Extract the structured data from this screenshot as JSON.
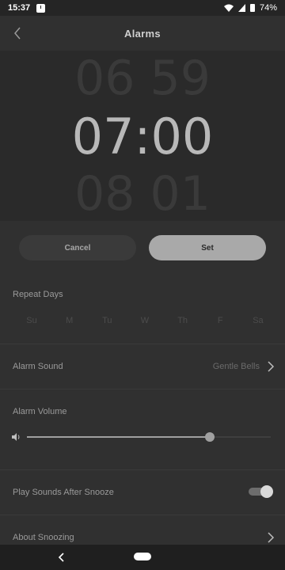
{
  "status_bar": {
    "time": "15:37",
    "battery": "74%"
  },
  "header": {
    "title": "Alarms"
  },
  "time_picker": {
    "previous": "06 59",
    "current": "07:00",
    "next": "08 01"
  },
  "actions": {
    "cancel_label": "Cancel",
    "set_label": "Set"
  },
  "repeat_days": {
    "label": "Repeat Days",
    "days": [
      "Su",
      "M",
      "Tu",
      "W",
      "Th",
      "F",
      "Sa"
    ]
  },
  "alarm_sound": {
    "label": "Alarm Sound",
    "value": "Gentle Bells"
  },
  "alarm_volume": {
    "label": "Alarm Volume",
    "level": 0.75
  },
  "play_after_snooze": {
    "label": "Play Sounds After Snooze",
    "enabled": true
  },
  "about_snoozing": {
    "label": "About Snoozing"
  },
  "colors": {
    "background": "#303030",
    "picker_bg": "#2a2a2a",
    "set_button": "#a9a9a9",
    "cancel_button": "#3a3a3a"
  }
}
